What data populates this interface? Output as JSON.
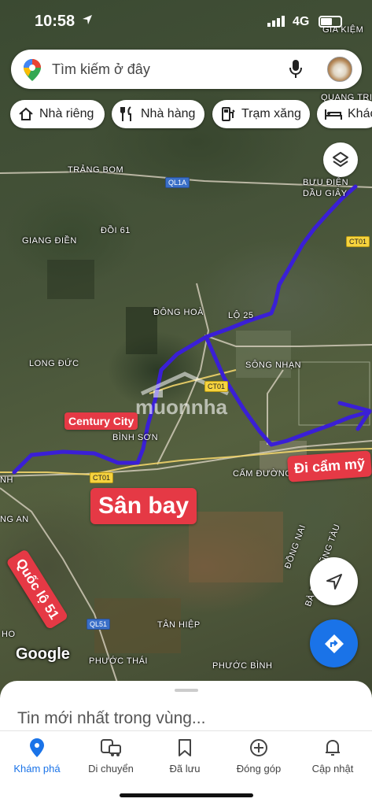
{
  "status_bar": {
    "time": "10:58",
    "network": "4G"
  },
  "search": {
    "placeholder": "Tìm kiếm ở đây"
  },
  "chips": [
    {
      "label": "Nhà riêng",
      "icon": "home-icon"
    },
    {
      "label": "Nhà hàng",
      "icon": "restaurant-icon"
    },
    {
      "label": "Trạm xăng",
      "icon": "gas-station-icon"
    },
    {
      "label": "Khác",
      "icon": "hotel-icon"
    }
  ],
  "map": {
    "places": [
      {
        "name": "GIA KIỆM"
      },
      {
        "name": "QUANG TRI"
      },
      {
        "name": "TRẢNG BOM"
      },
      {
        "name": "BƯU ĐIỆN"
      },
      {
        "name": "DẦU GIÂY"
      },
      {
        "name": "GIANG ĐIỀN"
      },
      {
        "name": "ĐỒI 61"
      },
      {
        "name": "ĐÔNG HOÀ"
      },
      {
        "name": "LỘ 25"
      },
      {
        "name": "LONG ĐỨC"
      },
      {
        "name": "SÔNG NHẠN"
      },
      {
        "name": "BÌNH SƠN"
      },
      {
        "name": "CẨM ĐƯỜNG"
      },
      {
        "name": "NH"
      },
      {
        "name": "NG AN"
      },
      {
        "name": "ĐỒNG NAI"
      },
      {
        "name": "BÀ RỊA - VŨNG TÀU"
      },
      {
        "name": "TÂN HIỆP"
      },
      {
        "name": "HO"
      },
      {
        "name": "PHƯỚC THÁI"
      },
      {
        "name": "PHƯỚC BÌNH"
      }
    ],
    "road_shields": [
      "QL1A",
      "CT01",
      "CT01",
      "CT01",
      "QL51"
    ],
    "annotations": {
      "century_city": "Century City",
      "airport": "Sân bay",
      "di_cam_my": "Đi cẩm mỹ",
      "quoc_lo_51": "Quốc lộ 51"
    },
    "watermark": "muonnha",
    "google_logo": "Google",
    "route_color": "#3a1fd6"
  },
  "sheet": {
    "title": "Tin mới nhất trong vùng..."
  },
  "nav": {
    "items": [
      {
        "label": "Khám phá",
        "icon": "explore-pin-icon",
        "active": true
      },
      {
        "label": "Di chuyển",
        "icon": "commute-icon",
        "active": false
      },
      {
        "label": "Đã lưu",
        "icon": "bookmark-icon",
        "active": false
      },
      {
        "label": "Đóng góp",
        "icon": "contribute-plus-icon",
        "active": false
      },
      {
        "label": "Cập nhật",
        "icon": "bell-icon",
        "active": false
      }
    ]
  }
}
